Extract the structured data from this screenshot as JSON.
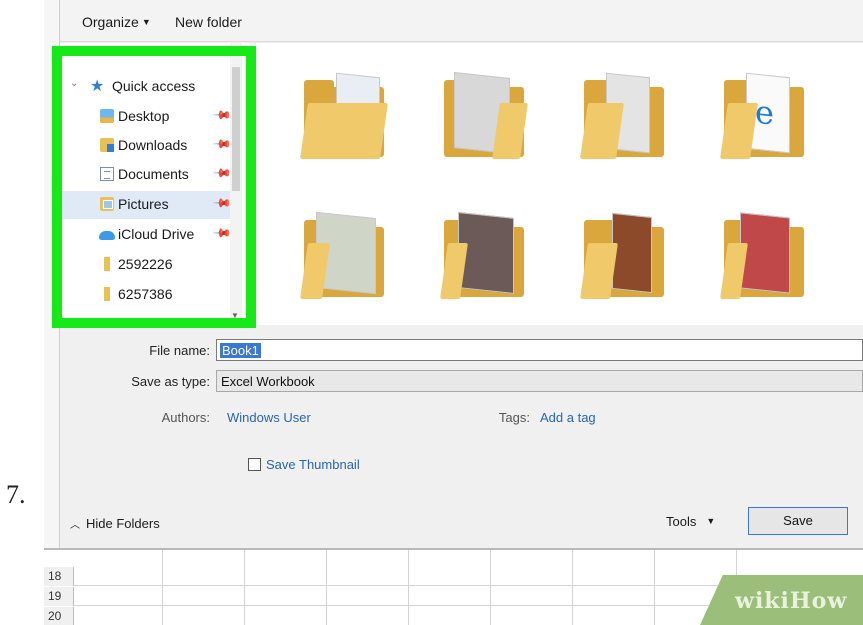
{
  "step": {
    "number": "7."
  },
  "toolbar": {
    "organize": "Organize",
    "new_folder": "New folder"
  },
  "nav": {
    "items": [
      {
        "label": "Quick access",
        "icon": "star-icon",
        "pinned": false
      },
      {
        "label": "Desktop",
        "icon": "desktop-folder-icon",
        "pinned": true
      },
      {
        "label": "Downloads",
        "icon": "downloads-folder-icon",
        "pinned": true
      },
      {
        "label": "Documents",
        "icon": "documents-icon",
        "pinned": true
      },
      {
        "label": "Pictures",
        "icon": "pictures-folder-icon",
        "pinned": true
      },
      {
        "label": "iCloud Drive",
        "icon": "icloud-icon",
        "pinned": true
      },
      {
        "label": "2592226",
        "icon": "folder-icon",
        "pinned": false
      },
      {
        "label": "6257386",
        "icon": "folder-icon",
        "pinned": false
      }
    ]
  },
  "form": {
    "file_name_label": "File name:",
    "file_name_value": "Book1",
    "save_type_label": "Save as type:",
    "save_type_value": "Excel Workbook",
    "authors_label": "Authors:",
    "authors_value": "Windows User",
    "tags_label": "Tags:",
    "tags_value": "Add a tag",
    "thumbnail_label": "Save Thumbnail"
  },
  "footer": {
    "hide_folders": "Hide Folders",
    "tools": "Tools",
    "save": "Save"
  },
  "sheet": {
    "rows": [
      "18",
      "19",
      "20"
    ]
  },
  "watermark": {
    "text": "wikiHow"
  },
  "colors": {
    "highlight": "#17e817",
    "accent": "#3a78d4",
    "link": "#2a64b0"
  }
}
